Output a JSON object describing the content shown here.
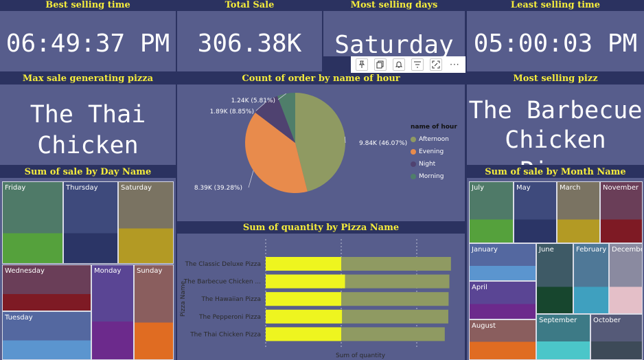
{
  "kpis": {
    "best_selling_time": {
      "title": "Best selling time",
      "value": "06:49:37 PM"
    },
    "total_sale": {
      "title": "Total Sale",
      "value": "306.38K"
    },
    "most_selling_days": {
      "title": "Most selling days",
      "value": "Saturday"
    },
    "least_selling_time": {
      "title": "Least selling time",
      "value": "05:00:03 PM"
    },
    "max_sale_pizza": {
      "title": "Max sale generating pizza",
      "value_line1": "The Thai",
      "value_line2": "Chicken Pizza"
    },
    "most_selling_pizza": {
      "title": "Most selling pizz",
      "value_line1": "The Barbecue",
      "value_line2": "Chicken Pizza"
    }
  },
  "toolbar": {
    "icons": [
      "pin-icon",
      "copy-icon",
      "bell-icon",
      "filter-icon",
      "focus-mode-icon",
      "more-options-icon"
    ]
  },
  "pie_chart": {
    "title": "Count of order by name of hour",
    "legend_title": "name of hour",
    "chart_data": {
      "type": "pie",
      "slices": [
        {
          "name": "Afternoon",
          "value": 9840,
          "label": "9.84K (46.07%)",
          "color": "#8f9a62"
        },
        {
          "name": "Evening",
          "value": 8390,
          "label": "8.39K (39.28%)",
          "color": "#e88b4c"
        },
        {
          "name": "Night",
          "value": 1890,
          "label": "1.89K (8.85%)",
          "color": "#4f4270"
        },
        {
          "name": "Morning",
          "value": 1240,
          "label": "1.24K (5.81%)",
          "color": "#4f7e6a"
        }
      ]
    }
  },
  "day_treemap": {
    "title": "Sum of sale by Day Name",
    "tiles": [
      {
        "label": "Friday",
        "top": "#4f7a68",
        "bottom": "#55a13c"
      },
      {
        "label": "Thursday",
        "top": "#3e4a7c",
        "bottom": "#2b3566"
      },
      {
        "label": "Saturday",
        "top": "#7a7362",
        "bottom": "#b39a24"
      },
      {
        "label": "Wednesday",
        "top": "#6a3e58",
        "bottom": "#7e1a24"
      },
      {
        "label": "Monday",
        "top": "#5a4594",
        "bottom": "#6c2a8c"
      },
      {
        "label": "Sunday",
        "top": "#8a5e5e",
        "bottom": "#e06c22"
      },
      {
        "label": "Tuesday",
        "top": "#5468a0",
        "bottom": "#5b95cf"
      }
    ]
  },
  "month_treemap": {
    "title": "Sum of sale by Month Name",
    "tiles": [
      {
        "label": "July",
        "top": "#4f7a68",
        "bottom": "#55a13c"
      },
      {
        "label": "May",
        "top": "#3e4a7c",
        "bottom": "#2b3566"
      },
      {
        "label": "March",
        "top": "#7a7362",
        "bottom": "#b39a24"
      },
      {
        "label": "November",
        "top": "#6a3e58",
        "bottom": "#7e1a24"
      },
      {
        "label": "January",
        "top": "#5468a0",
        "bottom": "#5b95cf"
      },
      {
        "label": "June",
        "top": "#3e5a66",
        "bottom": "#17462e"
      },
      {
        "label": "February",
        "top": "#4f7897",
        "bottom": "#3fa0bf"
      },
      {
        "label": "December",
        "top": "#8a8aa0",
        "bottom": "#e4bfc8"
      },
      {
        "label": "April",
        "top": "#5a4594",
        "bottom": "#6c2a8c"
      },
      {
        "label": "August",
        "top": "#8a5e5e",
        "bottom": "#e06c22"
      },
      {
        "label": "September",
        "top": "#3d7a86",
        "bottom": "#4bc6c9"
      },
      {
        "label": "October",
        "top": "#555a78",
        "bottom": "#3d4a58"
      }
    ]
  },
  "bar_chart": {
    "title": "Sum of quantity by Pizza Name",
    "chart_data": {
      "type": "bar",
      "orientation": "horizontal",
      "categories": [
        "The Classic Deluxe Pizza",
        "The Barbecue Chicken ...",
        "The Hawaiian Pizza",
        "The Pepperoni Pizza",
        "The Thai Chicken Pizza"
      ],
      "series": [
        {
          "values": [
            2453,
            2432,
            2422,
            2418,
            2371
          ],
          "color": "#8f9a62"
        },
        {
          "values": [
            1000,
            1050,
            1000,
            1010,
            1000
          ],
          "color": "#eef51f"
        }
      ],
      "xlabel": "Sum of quantity",
      "ylabel": "Pizza Name",
      "xlim": [
        0,
        2500
      ],
      "grid": true
    }
  }
}
